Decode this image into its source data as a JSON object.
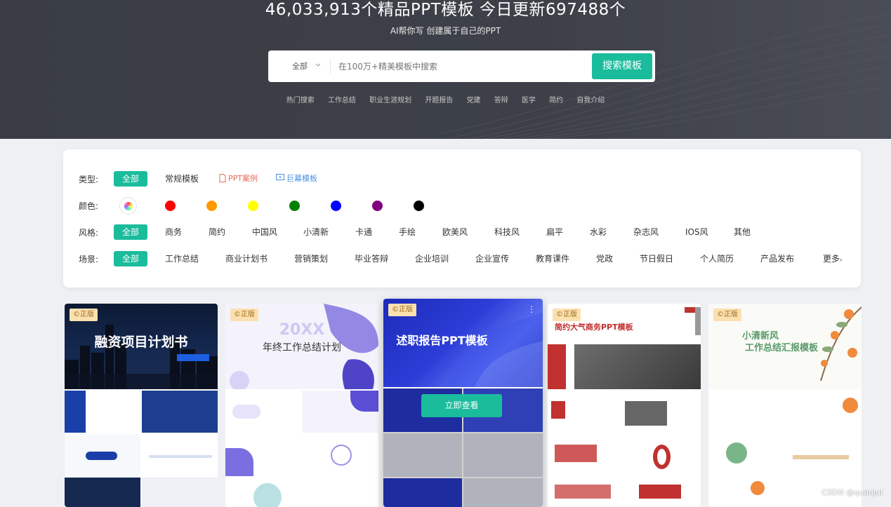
{
  "hero": {
    "title": "46,033,913个精品PPT模板 今日更新697488个",
    "subtitle": "AI帮你写 创建属于自己的PPT"
  },
  "search": {
    "category": "全部",
    "placeholder": "在100万+精美模板中搜索",
    "button": "搜索模板"
  },
  "hot_search": [
    "热门搜索",
    "工作总结",
    "职业生涯规划",
    "开题报告",
    "党建",
    "答辩",
    "医学",
    "简约",
    "自我介绍"
  ],
  "filters": {
    "type": {
      "label": "类型:",
      "items": [
        "全部",
        "常规模板",
        "PPT案例",
        "巨幕模板"
      ],
      "active": 0
    },
    "color": {
      "label": "颜色:",
      "colors": [
        "#ff0000",
        "#ff9900",
        "#ffff00",
        "#008000",
        "#0000ff",
        "#800080",
        "#000000"
      ]
    },
    "style": {
      "label": "风格:",
      "items": [
        "全部",
        "商务",
        "简约",
        "中国风",
        "小清新",
        "卡通",
        "手绘",
        "欧美风",
        "科技风",
        "扁平",
        "水彩",
        "杂志风",
        "IOS风",
        "其他"
      ],
      "active": 0
    },
    "scene": {
      "label": "场景:",
      "items": [
        "全部",
        "工作总结",
        "商业计划书",
        "营销策划",
        "毕业答辩",
        "企业培训",
        "企业宣传",
        "教育课件",
        "党政",
        "节日假日",
        "个人简历",
        "产品发布",
        "更多"
      ],
      "active": 0
    }
  },
  "cards": [
    {
      "badge": "©正版",
      "title": "融资项目计划书",
      "accent": "#1a3fa8"
    },
    {
      "badge": "©正版",
      "title": "年终工作总结计划",
      "big": "20XX",
      "accent": "#7a6ee0"
    },
    {
      "badge": "©正版",
      "title": "述职报告PPT模板",
      "accent": "#2636c9",
      "hover_button": "立即查看"
    },
    {
      "badge": "©正版",
      "title": "简约大气商务PPT模板",
      "accent": "#c0312f"
    },
    {
      "badge": "©正版",
      "title": "小清新风",
      "title2": "工作总结汇报模板",
      "accent": "#7ab58a"
    }
  ],
  "watermark": "CSDN @quanjui"
}
